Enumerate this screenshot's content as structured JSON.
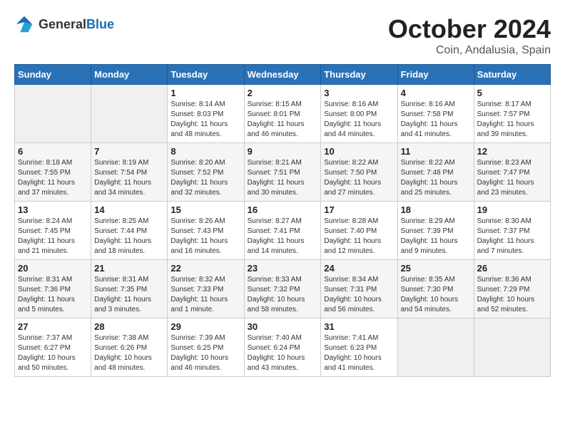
{
  "header": {
    "logo_general": "General",
    "logo_blue": "Blue",
    "month_title": "October 2024",
    "subtitle": "Coin, Andalusia, Spain"
  },
  "weekdays": [
    "Sunday",
    "Monday",
    "Tuesday",
    "Wednesday",
    "Thursday",
    "Friday",
    "Saturday"
  ],
  "weeks": [
    [
      {
        "day": "",
        "sunrise": "",
        "sunset": "",
        "daylight": ""
      },
      {
        "day": "",
        "sunrise": "",
        "sunset": "",
        "daylight": ""
      },
      {
        "day": "1",
        "sunrise": "Sunrise: 8:14 AM",
        "sunset": "Sunset: 8:03 PM",
        "daylight": "Daylight: 11 hours and 48 minutes."
      },
      {
        "day": "2",
        "sunrise": "Sunrise: 8:15 AM",
        "sunset": "Sunset: 8:01 PM",
        "daylight": "Daylight: 11 hours and 46 minutes."
      },
      {
        "day": "3",
        "sunrise": "Sunrise: 8:16 AM",
        "sunset": "Sunset: 8:00 PM",
        "daylight": "Daylight: 11 hours and 44 minutes."
      },
      {
        "day": "4",
        "sunrise": "Sunrise: 8:16 AM",
        "sunset": "Sunset: 7:58 PM",
        "daylight": "Daylight: 11 hours and 41 minutes."
      },
      {
        "day": "5",
        "sunrise": "Sunrise: 8:17 AM",
        "sunset": "Sunset: 7:57 PM",
        "daylight": "Daylight: 11 hours and 39 minutes."
      }
    ],
    [
      {
        "day": "6",
        "sunrise": "Sunrise: 8:18 AM",
        "sunset": "Sunset: 7:55 PM",
        "daylight": "Daylight: 11 hours and 37 minutes."
      },
      {
        "day": "7",
        "sunrise": "Sunrise: 8:19 AM",
        "sunset": "Sunset: 7:54 PM",
        "daylight": "Daylight: 11 hours and 34 minutes."
      },
      {
        "day": "8",
        "sunrise": "Sunrise: 8:20 AM",
        "sunset": "Sunset: 7:52 PM",
        "daylight": "Daylight: 11 hours and 32 minutes."
      },
      {
        "day": "9",
        "sunrise": "Sunrise: 8:21 AM",
        "sunset": "Sunset: 7:51 PM",
        "daylight": "Daylight: 11 hours and 30 minutes."
      },
      {
        "day": "10",
        "sunrise": "Sunrise: 8:22 AM",
        "sunset": "Sunset: 7:50 PM",
        "daylight": "Daylight: 11 hours and 27 minutes."
      },
      {
        "day": "11",
        "sunrise": "Sunrise: 8:22 AM",
        "sunset": "Sunset: 7:48 PM",
        "daylight": "Daylight: 11 hours and 25 minutes."
      },
      {
        "day": "12",
        "sunrise": "Sunrise: 8:23 AM",
        "sunset": "Sunset: 7:47 PM",
        "daylight": "Daylight: 11 hours and 23 minutes."
      }
    ],
    [
      {
        "day": "13",
        "sunrise": "Sunrise: 8:24 AM",
        "sunset": "Sunset: 7:45 PM",
        "daylight": "Daylight: 11 hours and 21 minutes."
      },
      {
        "day": "14",
        "sunrise": "Sunrise: 8:25 AM",
        "sunset": "Sunset: 7:44 PM",
        "daylight": "Daylight: 11 hours and 18 minutes."
      },
      {
        "day": "15",
        "sunrise": "Sunrise: 8:26 AM",
        "sunset": "Sunset: 7:43 PM",
        "daylight": "Daylight: 11 hours and 16 minutes."
      },
      {
        "day": "16",
        "sunrise": "Sunrise: 8:27 AM",
        "sunset": "Sunset: 7:41 PM",
        "daylight": "Daylight: 11 hours and 14 minutes."
      },
      {
        "day": "17",
        "sunrise": "Sunrise: 8:28 AM",
        "sunset": "Sunset: 7:40 PM",
        "daylight": "Daylight: 11 hours and 12 minutes."
      },
      {
        "day": "18",
        "sunrise": "Sunrise: 8:29 AM",
        "sunset": "Sunset: 7:39 PM",
        "daylight": "Daylight: 11 hours and 9 minutes."
      },
      {
        "day": "19",
        "sunrise": "Sunrise: 8:30 AM",
        "sunset": "Sunset: 7:37 PM",
        "daylight": "Daylight: 11 hours and 7 minutes."
      }
    ],
    [
      {
        "day": "20",
        "sunrise": "Sunrise: 8:31 AM",
        "sunset": "Sunset: 7:36 PM",
        "daylight": "Daylight: 11 hours and 5 minutes."
      },
      {
        "day": "21",
        "sunrise": "Sunrise: 8:31 AM",
        "sunset": "Sunset: 7:35 PM",
        "daylight": "Daylight: 11 hours and 3 minutes."
      },
      {
        "day": "22",
        "sunrise": "Sunrise: 8:32 AM",
        "sunset": "Sunset: 7:33 PM",
        "daylight": "Daylight: 11 hours and 1 minute."
      },
      {
        "day": "23",
        "sunrise": "Sunrise: 8:33 AM",
        "sunset": "Sunset: 7:32 PM",
        "daylight": "Daylight: 10 hours and 58 minutes."
      },
      {
        "day": "24",
        "sunrise": "Sunrise: 8:34 AM",
        "sunset": "Sunset: 7:31 PM",
        "daylight": "Daylight: 10 hours and 56 minutes."
      },
      {
        "day": "25",
        "sunrise": "Sunrise: 8:35 AM",
        "sunset": "Sunset: 7:30 PM",
        "daylight": "Daylight: 10 hours and 54 minutes."
      },
      {
        "day": "26",
        "sunrise": "Sunrise: 8:36 AM",
        "sunset": "Sunset: 7:29 PM",
        "daylight": "Daylight: 10 hours and 52 minutes."
      }
    ],
    [
      {
        "day": "27",
        "sunrise": "Sunrise: 7:37 AM",
        "sunset": "Sunset: 6:27 PM",
        "daylight": "Daylight: 10 hours and 50 minutes."
      },
      {
        "day": "28",
        "sunrise": "Sunrise: 7:38 AM",
        "sunset": "Sunset: 6:26 PM",
        "daylight": "Daylight: 10 hours and 48 minutes."
      },
      {
        "day": "29",
        "sunrise": "Sunrise: 7:39 AM",
        "sunset": "Sunset: 6:25 PM",
        "daylight": "Daylight: 10 hours and 46 minutes."
      },
      {
        "day": "30",
        "sunrise": "Sunrise: 7:40 AM",
        "sunset": "Sunset: 6:24 PM",
        "daylight": "Daylight: 10 hours and 43 minutes."
      },
      {
        "day": "31",
        "sunrise": "Sunrise: 7:41 AM",
        "sunset": "Sunset: 6:23 PM",
        "daylight": "Daylight: 10 hours and 41 minutes."
      },
      {
        "day": "",
        "sunrise": "",
        "sunset": "",
        "daylight": ""
      },
      {
        "day": "",
        "sunrise": "",
        "sunset": "",
        "daylight": ""
      }
    ]
  ]
}
